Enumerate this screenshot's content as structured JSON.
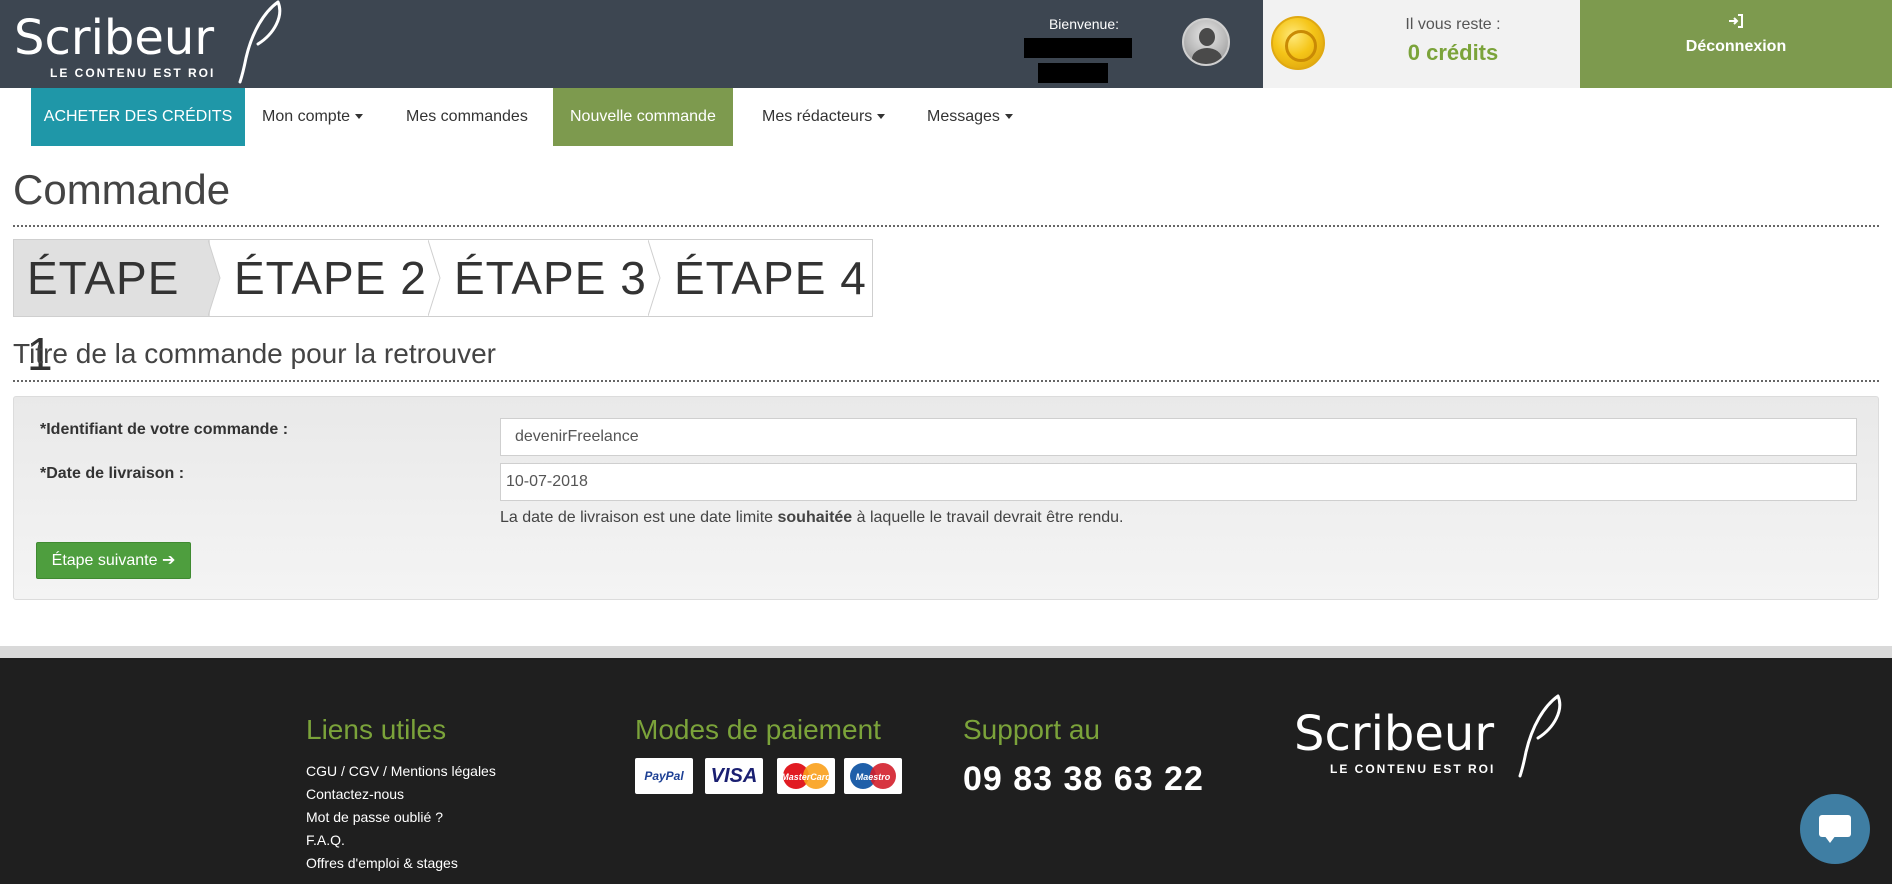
{
  "header": {
    "logo_text": "Scribeur",
    "logo_tagline": "LE CONTENU EST ROI",
    "welcome": "Bienvenue:",
    "credits_label": "Il vous reste :",
    "credits_value": "0 crédits",
    "logout_icon": "sign-in-icon",
    "logout_label": "Déconnexion"
  },
  "nav": {
    "buy": "ACHETER DES CRÉDITS",
    "account": "Mon compte",
    "orders": "Mes commandes",
    "new_order": "Nouvelle commande",
    "writers": "Mes rédacteurs",
    "messages": "Messages"
  },
  "page": {
    "title": "Commande",
    "steps": [
      "ÉTAPE 1",
      "ÉTAPE 2",
      "ÉTAPE 3",
      "ÉTAPE 4"
    ],
    "active_step": 1,
    "section_title": "Titre de la commande pour la retrouver"
  },
  "form": {
    "id_label": "*Identifiant de votre commande :",
    "id_value": "devenirFreelance",
    "date_label": "*Date de livraison :",
    "date_value": "10-07-2018",
    "help_before": "La date de livraison est une date limite ",
    "help_bold": "souhaitée",
    "help_after": " à laquelle le travail devrait être rendu.",
    "next_button": "Étape suivante ➔"
  },
  "footer": {
    "links_title": "Liens utiles",
    "links": [
      "CGU / CGV / Mentions légales",
      "Contactez-nous",
      "Mot de passe oublié ?",
      "F.A.Q.",
      "Offres d'emploi & stages"
    ],
    "payment_title": "Modes de paiement",
    "payment_methods": [
      "PayPal",
      "VISA",
      "MasterCard",
      "Maestro"
    ],
    "support_title": "Support au",
    "phone": "09 83 38 63 22",
    "logo_text": "Scribeur",
    "logo_tagline": "LE CONTENU EST ROI"
  },
  "colors": {
    "header_bg": "#3d4651",
    "accent_green": "#7d9a4e",
    "accent_teal": "#1f97a8",
    "credits_green": "#7ba33a",
    "button_green": "#4e9e3e",
    "footer_bg": "#1f1f1f"
  }
}
